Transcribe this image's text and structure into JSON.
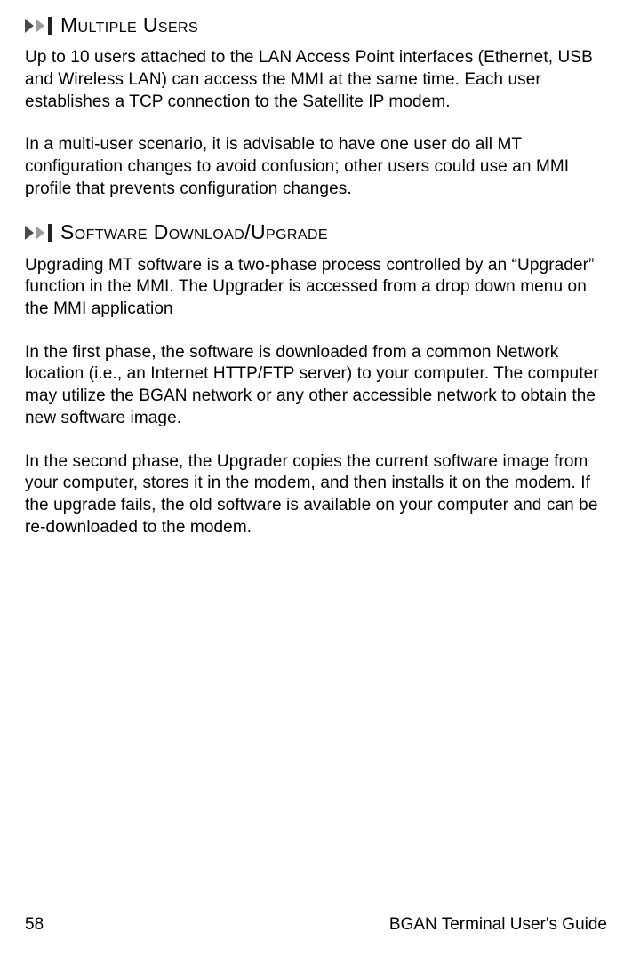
{
  "sections": [
    {
      "heading": "Multiple Users",
      "paragraphs": [
        "Up to 10 users attached to the LAN Access Point interfaces (Ethernet, USB and Wireless LAN) can access the MMI at the same time. Each user establishes a TCP connection to the Satellite IP modem.",
        "In a multi-user scenario, it is advisable to have one user do all MT configuration changes to avoid confusion; other users could use an MMI profile that prevents configuration changes."
      ]
    },
    {
      "heading": "Software Download/Upgrade",
      "paragraphs": [
        "Upgrading MT software is a two-phase process controlled by an “Upgrader” function in the MMI. The Upgrader is accessed from a drop down menu on the MMI application",
        "In the first phase, the software is downloaded from a common Network location (i.e., an Internet HTTP/FTP server) to your computer. The computer may utilize the BGAN network or any other accessible network to obtain the new software image.",
        "In the second phase, the Upgrader copies the current software image from your computer, stores it in the modem, and then installs it on the modem. If the upgrade fails, the old software is available on your computer and can be re-downloaded to the modem."
      ]
    }
  ],
  "footer": {
    "page": "58",
    "title": "BGAN Terminal User's Guide"
  }
}
